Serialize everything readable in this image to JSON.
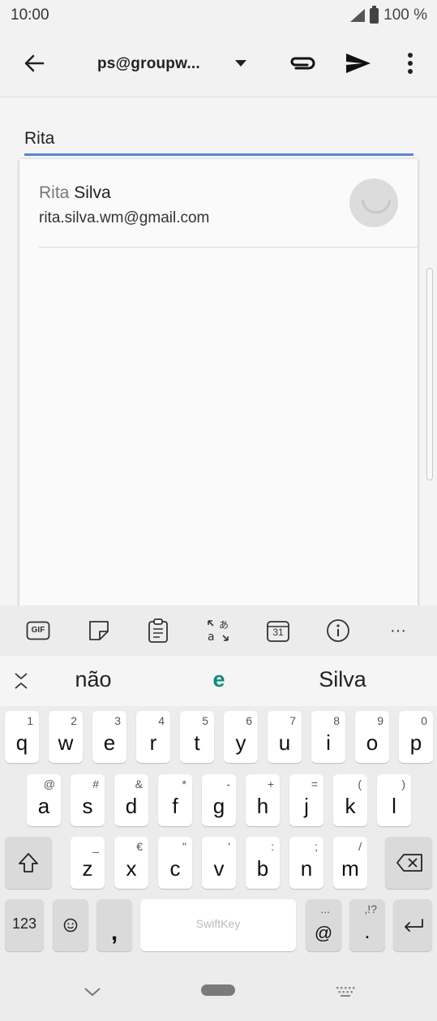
{
  "status": {
    "time": "10:00",
    "battery": "100 %"
  },
  "app_bar": {
    "back_icon": "arrow-left-icon",
    "from_account": "ps@groupw...",
    "attach_icon": "paperclip-icon",
    "send_icon": "send-icon",
    "more_icon": "more-vert-icon"
  },
  "compose": {
    "to_value": "Rita"
  },
  "suggestions": [
    {
      "name_match": "Rita",
      "name_rest": " Silva",
      "email": "rita.silva.wm@gmail.com"
    }
  ],
  "keyboard": {
    "toolbar": {
      "gif": "GIF",
      "calendar_day": "31",
      "more": "···"
    },
    "predictions": {
      "left": "não",
      "middle": "e",
      "right": "Silva"
    },
    "row1": [
      {
        "main": "q",
        "sub": "1"
      },
      {
        "main": "w",
        "sub": "2"
      },
      {
        "main": "e",
        "sub": "3"
      },
      {
        "main": "r",
        "sub": "4"
      },
      {
        "main": "t",
        "sub": "5"
      },
      {
        "main": "y",
        "sub": "6"
      },
      {
        "main": "u",
        "sub": "7"
      },
      {
        "main": "i",
        "sub": "8"
      },
      {
        "main": "o",
        "sub": "9"
      },
      {
        "main": "p",
        "sub": "0"
      }
    ],
    "row2": [
      {
        "main": "a",
        "sub": "@"
      },
      {
        "main": "s",
        "sub": "#"
      },
      {
        "main": "d",
        "sub": "&"
      },
      {
        "main": "f",
        "sub": "*"
      },
      {
        "main": "g",
        "sub": "-"
      },
      {
        "main": "h",
        "sub": "+"
      },
      {
        "main": "j",
        "sub": "="
      },
      {
        "main": "k",
        "sub": "("
      },
      {
        "main": "l",
        "sub": ")"
      }
    ],
    "row3": [
      {
        "main": "z",
        "sub": "_"
      },
      {
        "main": "x",
        "sub": "€"
      },
      {
        "main": "c",
        "sub": "\""
      },
      {
        "main": "v",
        "sub": "'"
      },
      {
        "main": "b",
        "sub": ":"
      },
      {
        "main": "n",
        "sub": ";"
      },
      {
        "main": "m",
        "sub": "/"
      }
    ],
    "bottom": {
      "num_label": "123",
      "comma": ",",
      "space_brand": "SwiftKey",
      "at_main": "@",
      "at_sub": "...",
      "period_main": ".",
      "period_sub": ",!?"
    }
  }
}
